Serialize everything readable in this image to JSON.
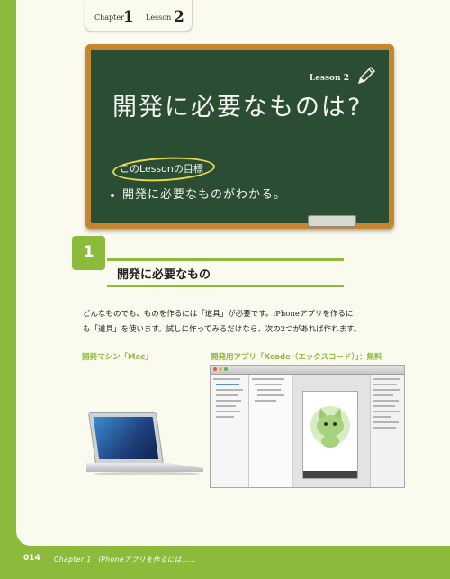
{
  "tab": {
    "chapter_label": "Chapter",
    "chapter_num": "1",
    "lesson_label": "Lesson",
    "lesson_num": "2"
  },
  "board": {
    "lesson_tag": "Lesson 2",
    "title": "開発に必要なものは?",
    "goal_label": "このLessonの目標",
    "goal_item": "開発に必要なものがわかる。"
  },
  "section": {
    "number": "1",
    "title": "開発に必要なもの"
  },
  "body": {
    "line1": "どんなものでも、ものを作るには「道具」が必要です。iPhoneアプリを作るに",
    "line2": "も「道具」を使います。試しに作ってみるだけなら、次の2つがあれば作れます。"
  },
  "captions": {
    "mac": "開発マシン「Mac」",
    "xcode": "開発用アプリ「Xcode（エックスコード）」：無料"
  },
  "footer": {
    "page_num": "014",
    "chapter_text": "Chapter 1　iPhoneアプリを作るには……"
  },
  "colors": {
    "accent": "#8cbb3c",
    "board": "#2b4d33",
    "frame": "#c6862f",
    "paper": "#fbfaee"
  }
}
